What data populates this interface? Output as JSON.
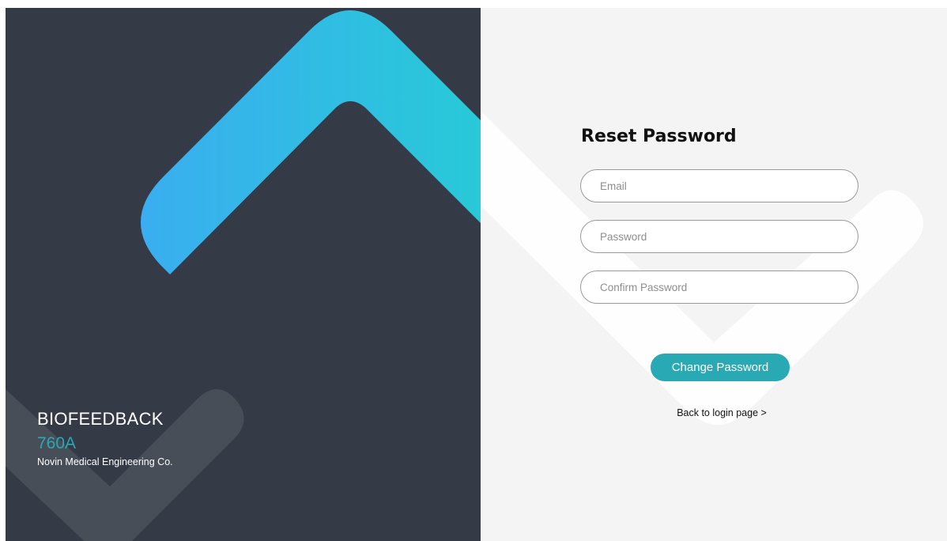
{
  "brand": {
    "title": "BIOFEEDBACK",
    "model": "760A",
    "company": "Novin Medical Engineering Co."
  },
  "form": {
    "title": "Reset Password",
    "email_placeholder": "Email",
    "password_placeholder": "Password",
    "confirm_placeholder": "Confirm Password",
    "submit_label": "Change Password",
    "back_link": "Back to login page >"
  },
  "colors": {
    "left_bg": "#343a46",
    "right_bg": "#f4f4f4",
    "accent": "#28a9b4",
    "chevron_start": "#3aaef0",
    "chevron_end": "#28c9d8"
  }
}
